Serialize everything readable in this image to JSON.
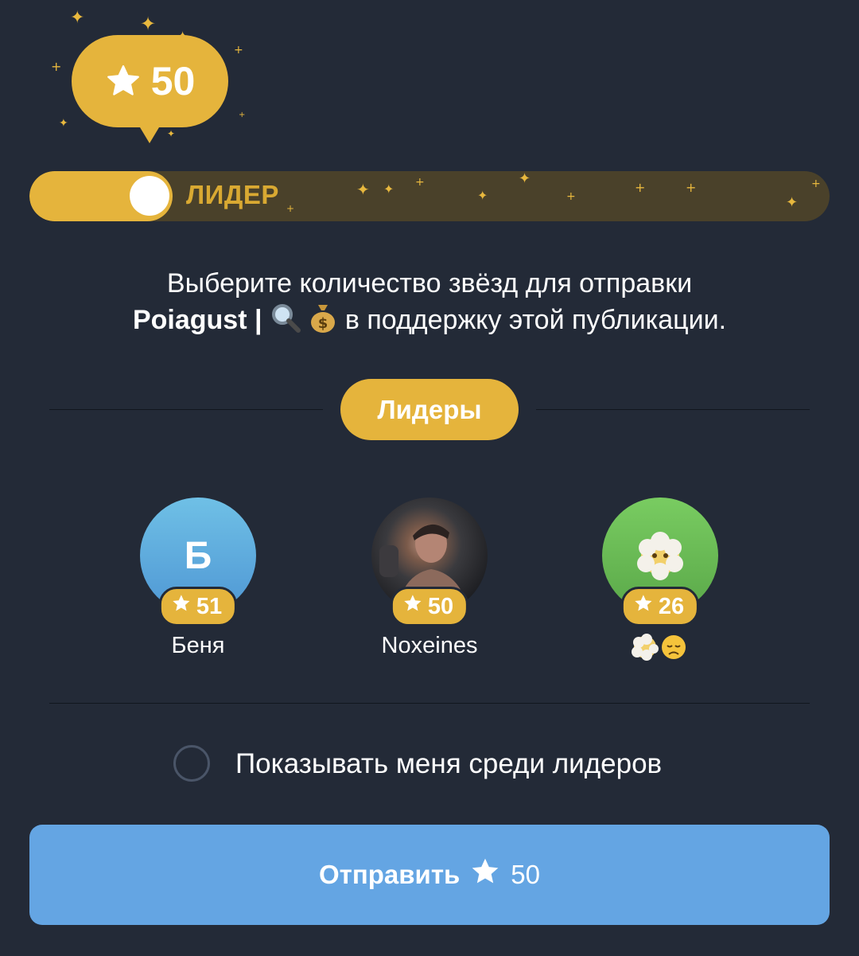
{
  "bubble": {
    "count": "50"
  },
  "slider": {
    "label": "ЛИДЕР"
  },
  "description": {
    "line1": "Выберите количество звёзд для отправки",
    "channel_name": "Poiagust |",
    "line2_suffix": "в поддержку этой публикации."
  },
  "leaders_pill": "Лидеры",
  "leaders": [
    {
      "initial": "Б",
      "stars": "51",
      "name": "Беня"
    },
    {
      "initial": "",
      "stars": "50",
      "name": "Noxeines"
    },
    {
      "initial": "",
      "stars": "26",
      "name": ""
    }
  ],
  "show_me": {
    "label": "Показывать меня среди лидеров"
  },
  "send_button": {
    "label": "Отправить",
    "count": "50"
  },
  "colors": {
    "background": "#232a37",
    "gold": "#e5b43c",
    "button_blue": "#64a5e3"
  },
  "icons": [
    "star-icon",
    "magnifier-emoji",
    "money-bag-emoji",
    "face-in-clouds-emoji",
    "disappointed-face-emoji"
  ]
}
